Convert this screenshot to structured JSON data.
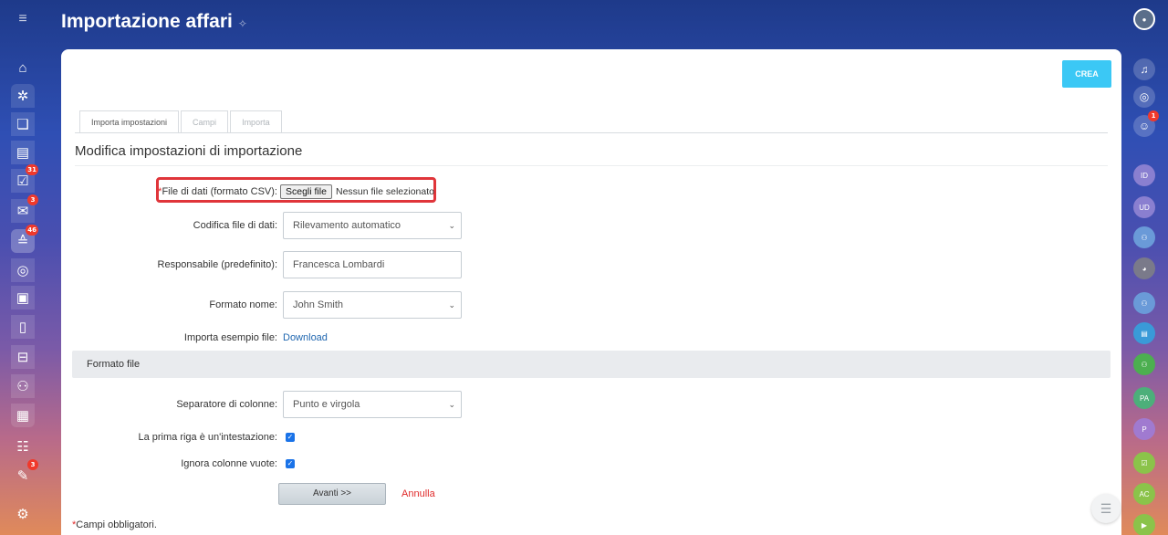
{
  "header": {
    "title": "Importazione affari"
  },
  "left_sidebar": {
    "badges": {
      "tasks": "31",
      "mail": "3",
      "crm": "46",
      "approvals": "3"
    }
  },
  "right_sidebar": {
    "notification_badge": "1",
    "avatars": [
      "ID",
      "UD",
      "PA",
      "P",
      "AC"
    ]
  },
  "toolbar": {
    "create_label": "CREA"
  },
  "tabs": [
    {
      "label": "Importa impostazioni",
      "active": true
    },
    {
      "label": "Campi",
      "active": false
    },
    {
      "label": "Importa",
      "active": false
    }
  ],
  "form": {
    "section_title": "Modifica impostazioni di importazione",
    "file": {
      "required_mark": "*",
      "label": "File di dati (formato CSV):",
      "button_label": "Scegli file",
      "status": "Nessun file selezionato"
    },
    "encoding": {
      "label": "Codifica file di dati:",
      "value": "Rilevamento automatico"
    },
    "responsible": {
      "label": "Responsabile (predefinito):",
      "value": "Francesca Lombardi"
    },
    "name_format": {
      "label": "Formato nome:",
      "value": "John Smith"
    },
    "example": {
      "label": "Importa esempio file:",
      "link": "Download"
    },
    "file_format_band": "Formato file",
    "separator": {
      "label": "Separatore di colonne:",
      "value": "Punto e virgola"
    },
    "first_row_header": {
      "label": "La prima riga è un'intestazione:",
      "checked": true
    },
    "ignore_empty": {
      "label": "Ignora colonne vuote:",
      "checked": true
    },
    "next_label": "Avanti >>",
    "cancel_label": "Annulla",
    "required_mark": "*",
    "required_note": "Campi obbligatori."
  },
  "colors": {
    "accent": "#3bc8f5",
    "danger": "#e02b2b",
    "link": "#2067b0",
    "checkbox": "#1a73e8"
  }
}
